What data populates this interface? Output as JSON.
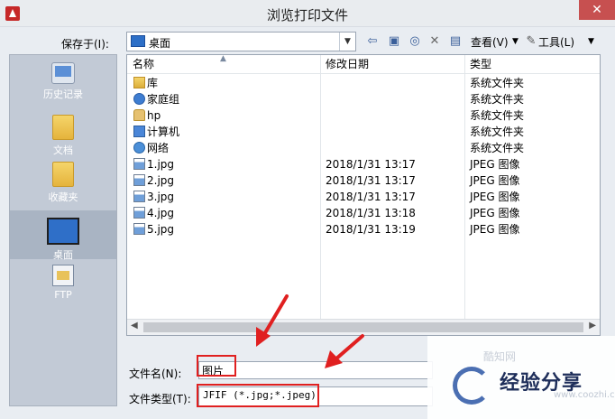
{
  "window": {
    "title": "浏览打印文件",
    "close_glyph": "✕"
  },
  "toolbar": {
    "save_in_label": "保存于(I):",
    "location": "桌面",
    "view_label": "查看(V)",
    "tools_label": "工具(L)",
    "icons": [
      "back-icon",
      "up-folder-icon",
      "search-web-icon",
      "delete-icon",
      "new-folder-icon"
    ]
  },
  "places": [
    {
      "label": "历史记录",
      "icon": "history-icon"
    },
    {
      "label": "文档",
      "icon": "documents-icon"
    },
    {
      "label": "收藏夹",
      "icon": "favorites-icon"
    },
    {
      "label": "桌面",
      "icon": "desktop-icon"
    },
    {
      "label": "FTP",
      "icon": "ftp-icon"
    }
  ],
  "filelist": {
    "columns": [
      "名称",
      "修改日期",
      "类型"
    ],
    "rows": [
      {
        "name": "库",
        "date": "",
        "type": "系统文件夹",
        "icon": "library-icon"
      },
      {
        "name": "家庭组",
        "date": "",
        "type": "系统文件夹",
        "icon": "homegroup-icon"
      },
      {
        "name": "hp",
        "date": "",
        "type": "系统文件夹",
        "icon": "user-folder-icon"
      },
      {
        "name": "计算机",
        "date": "",
        "type": "系统文件夹",
        "icon": "computer-icon"
      },
      {
        "name": "网络",
        "date": "",
        "type": "系统文件夹",
        "icon": "network-icon"
      },
      {
        "name": "1.jpg",
        "date": "2018/1/31 13:17",
        "type": "JPEG 图像",
        "icon": "jpg-file-icon"
      },
      {
        "name": "2.jpg",
        "date": "2018/1/31 13:17",
        "type": "JPEG 图像",
        "icon": "jpg-file-icon"
      },
      {
        "name": "3.jpg",
        "date": "2018/1/31 13:17",
        "type": "JPEG 图像",
        "icon": "jpg-file-icon"
      },
      {
        "name": "4.jpg",
        "date": "2018/1/31 13:18",
        "type": "JPEG 图像",
        "icon": "jpg-file-icon"
      },
      {
        "name": "5.jpg",
        "date": "2018/1/31 13:19",
        "type": "JPEG 图像",
        "icon": "jpg-file-icon"
      }
    ]
  },
  "file_name": {
    "label": "文件名(N):",
    "value": "图片"
  },
  "file_type": {
    "label": "文件类型(T):",
    "value": "JFIF (*.jpg;*.jpeg)"
  },
  "watermark": {
    "text": "经验分享",
    "small": "酷知网",
    "sub": "www.coozhi.com"
  },
  "colors": {
    "highlight": "#e02020",
    "accent": "#2f6fc8"
  }
}
